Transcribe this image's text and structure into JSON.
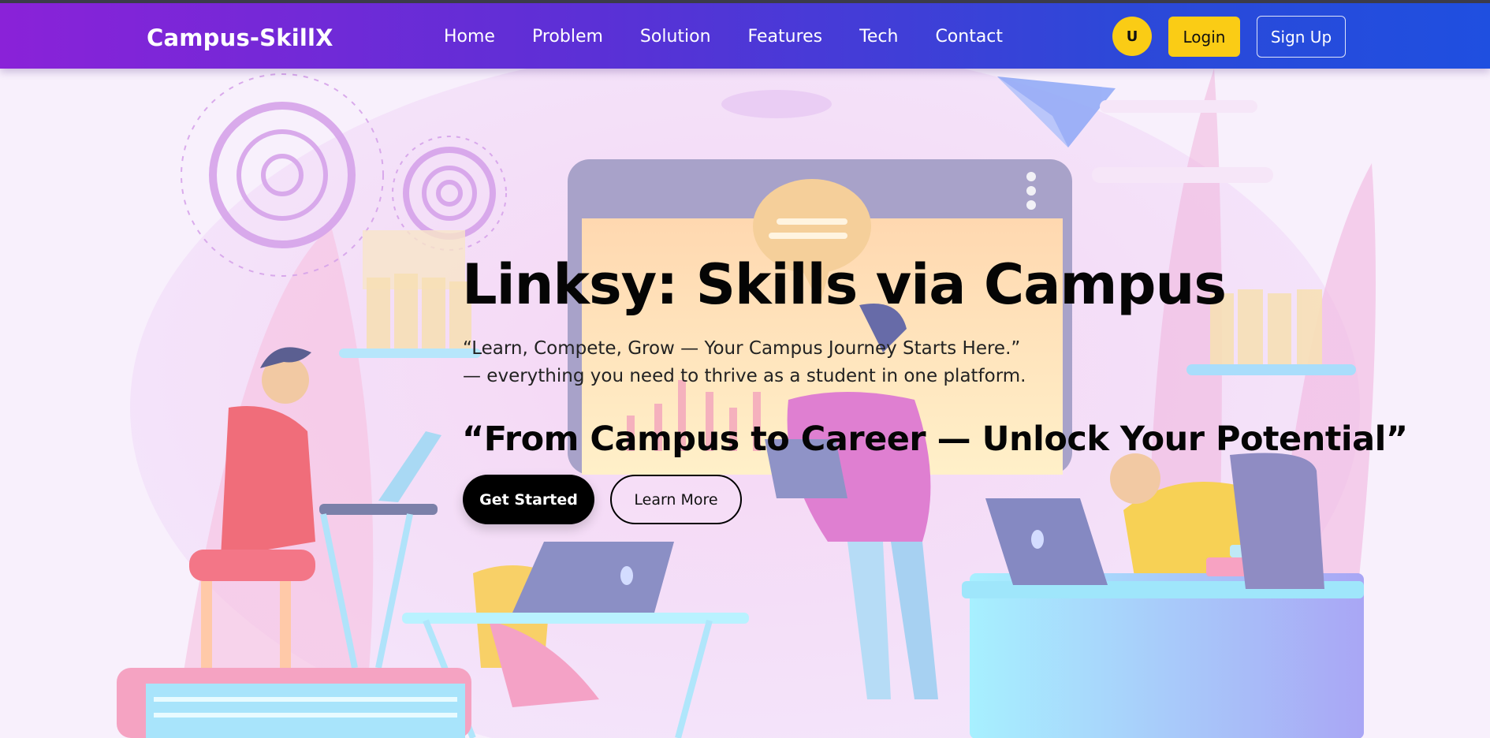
{
  "nav": {
    "brand": "Campus-SkillX",
    "links": [
      "Home",
      "Problem",
      "Solution",
      "Features",
      "Tech",
      "Contact"
    ],
    "avatar_initial": "U",
    "login_label": "Login",
    "signup_label": "Sign Up"
  },
  "hero": {
    "title": "Linksy: Skills via Campus",
    "subtitle": "“Learn, Compete, Grow — Your Campus Journey Starts Here.” — everything you need to thrive as a student in one platform.",
    "tagline": "“From Campus to Career — Unlock Your Potential”",
    "primary_button": "Get Started",
    "secondary_button": "Learn More"
  },
  "colors": {
    "nav_gradient_start": "#8a22d8",
    "nav_gradient_end": "#1f4fe0",
    "accent_yellow": "#facc15",
    "hero_text": "#050505"
  },
  "icons": [
    "gear-icon",
    "paper-plane-icon",
    "laptop-icon",
    "chat-bubble-icon"
  ]
}
